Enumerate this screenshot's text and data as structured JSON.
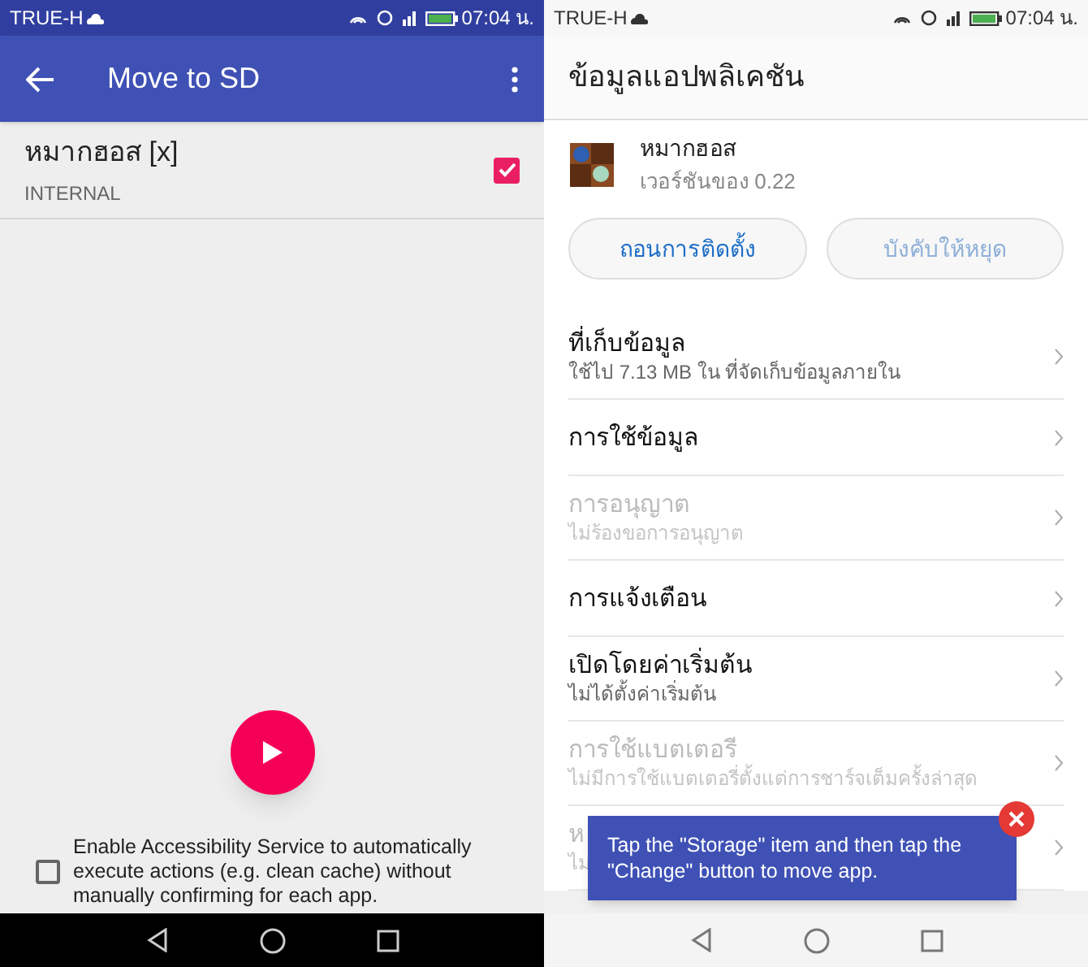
{
  "left": {
    "status_bar": {
      "carrier": "TRUE-H",
      "time": "07:04 น."
    },
    "app_bar": {
      "title": "Move to SD"
    },
    "apps": [
      {
        "name": "หมากฮอส [x]",
        "location": "INTERNAL",
        "checked": true
      }
    ],
    "accessibility": {
      "label": "Enable Accessibility Service to automatically execute actions (e.g. clean cache) without manually confirming for each app.",
      "checked": false
    }
  },
  "right": {
    "status_bar": {
      "carrier": "TRUE-H",
      "time": "07:04 น."
    },
    "header": {
      "title": "ข้อมูลแอปพลิเคชัน"
    },
    "app": {
      "name": "หมากฮอส",
      "version": "เวอร์ชันของ 0.22"
    },
    "buttons": [
      {
        "label": "ถอนการติดตั้ง",
        "disabled": false
      },
      {
        "label": "บังคับให้หยุด",
        "disabled": true
      }
    ],
    "items": [
      {
        "title": "ที่เก็บข้อมูล",
        "subtitle": "ใช้ไป 7.13 MB ใน ที่จัดเก็บข้อมูลภายใน",
        "disabled": false
      },
      {
        "title": "การใช้ข้อมูล",
        "disabled": false
      },
      {
        "title": "การอนุญาต",
        "subtitle": "ไม่ร้องขอการอนุญาต",
        "disabled": true
      },
      {
        "title": "การแจ้งเตือน",
        "disabled": false
      },
      {
        "title": "เปิดโดยค่าเริ่มต้น",
        "subtitle": "ไม่ได้ตั้งค่าเริ่มต้น",
        "disabled": false
      },
      {
        "title": "การใช้แบตเตอรี",
        "subtitle": "ไม่มีการใช้แบตเตอรี่ตั้งแต่การชาร์จเต็มครั้งล่าสุด",
        "disabled": true
      },
      {
        "title": "ห",
        "subtitle": "ไม่",
        "disabled": true
      }
    ],
    "tooltip": {
      "text": "Tap the \"Storage\" item and then tap the \"Change\" button to move app."
    }
  }
}
